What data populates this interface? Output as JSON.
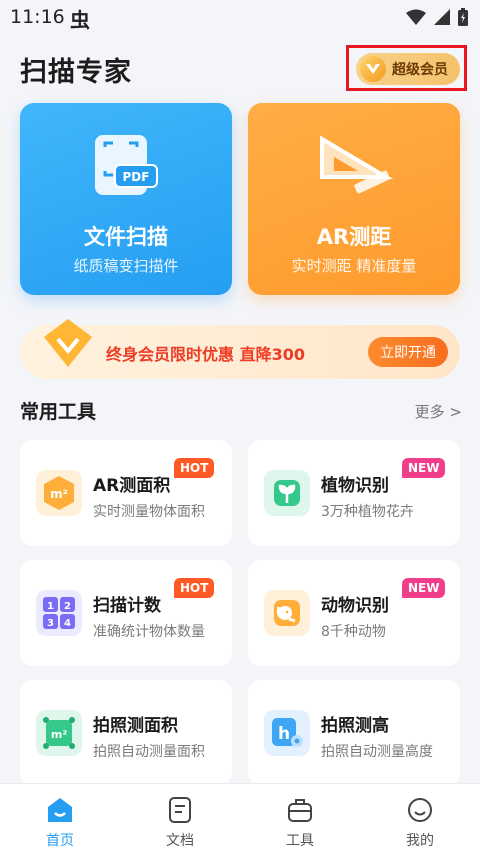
{
  "status_bar": {
    "time": "11:16",
    "app_glyph": "虫"
  },
  "header": {
    "title": "扫描专家",
    "vip_label": "超级会员"
  },
  "cards": [
    {
      "title": "文件扫描",
      "subtitle": "纸质稿变扫描件",
      "icon_text": "PDF"
    },
    {
      "title": "AR测距",
      "subtitle": "实时测距 精准度量"
    }
  ],
  "promo": {
    "text": "终身会员限时优惠 直降300",
    "button": "立即开通"
  },
  "tools_section": {
    "title": "常用工具",
    "more": "更多 >"
  },
  "tools": [
    {
      "name": "AR测面积",
      "desc": "实时测量物体面积",
      "tag": "HOT",
      "icon_text": "m²"
    },
    {
      "name": "植物识别",
      "desc": "3万种植物花卉",
      "tag": "NEW"
    },
    {
      "name": "扫描计数",
      "desc": "准确统计物体数量",
      "tag": "HOT",
      "icon_text": [
        "1",
        "2",
        "3",
        "4"
      ]
    },
    {
      "name": "动物识别",
      "desc": "8千种动物",
      "tag": "NEW"
    },
    {
      "name": "拍照测面积",
      "desc": "拍照自动测量面积",
      "icon_text": "m²"
    },
    {
      "name": "拍照测高",
      "desc": "拍照自动测量高度",
      "icon_text": "h"
    }
  ],
  "tabs": [
    {
      "label": "首页",
      "active": true
    },
    {
      "label": "文档"
    },
    {
      "label": "工具"
    },
    {
      "label": "我的"
    }
  ],
  "colors": {
    "primary_blue": "#259ef2",
    "orange": "#ff9a2c",
    "hot_tag": "#ff5a25",
    "new_tag": "#f23e8a",
    "highlight_red": "#e8161d"
  }
}
